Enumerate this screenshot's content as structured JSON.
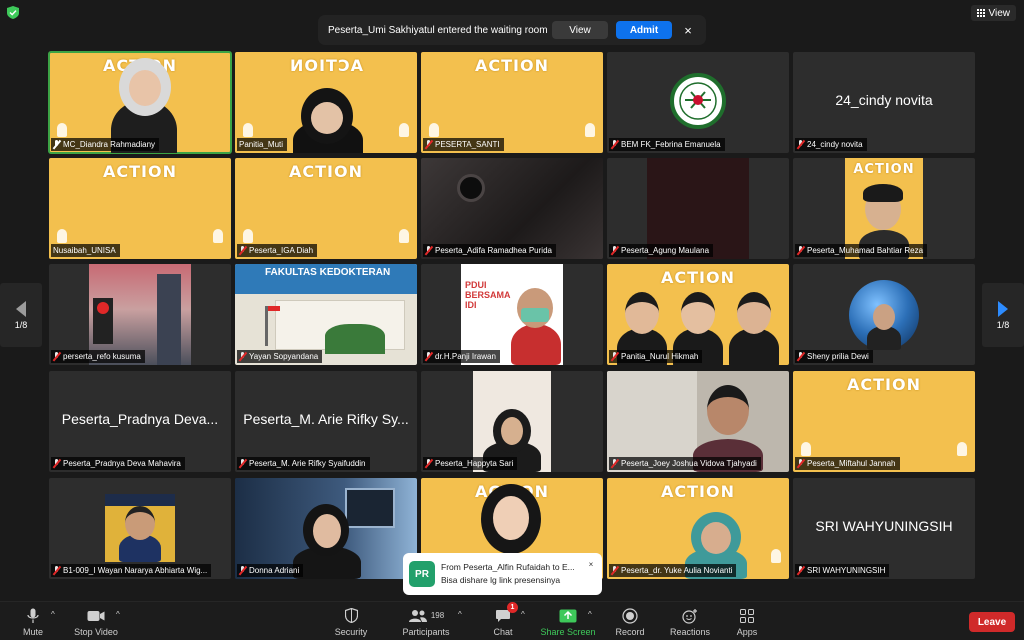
{
  "top": {
    "view_label": "View",
    "notification": {
      "text": "Peserta_Umi Sakhiyatul entered the waiting room",
      "view_label": "View",
      "admit_label": "Admit",
      "close_glyph": "×"
    }
  },
  "pagination": {
    "left": "1/8",
    "right": "1/8"
  },
  "tiles": [
    {
      "name": "MC_Diandra Rahmadiany",
      "mic": "muted-white"
    },
    {
      "name": "Panitia_Muti",
      "mic": "none"
    },
    {
      "name": "PESERTA_SANTI",
      "mic": "muted"
    },
    {
      "name": "BEM FK_Febrina Emanuela",
      "mic": "muted"
    },
    {
      "name": "24_cindy novita",
      "big": "24_cindy novita",
      "mic": "muted"
    },
    {
      "name": "Nusaibah_UNISA",
      "mic": "none"
    },
    {
      "name": "Peserta_IGA Diah",
      "mic": "muted"
    },
    {
      "name": "Peserta_Adifa Ramadhea Purida",
      "mic": "muted"
    },
    {
      "name": "Peserta_Agung Maulana",
      "mic": "muted"
    },
    {
      "name": "Peserta_Muhamad Bahtiar Reza",
      "mic": "muted"
    },
    {
      "name": "perserta_refo kusuma",
      "mic": "muted"
    },
    {
      "name": "Yayan Sopyandana",
      "mic": "muted"
    },
    {
      "name": "dr.H.Panji Irawan",
      "mic": "muted"
    },
    {
      "name": "Panitia_Nurul Hikmah",
      "mic": "muted"
    },
    {
      "name": "Sheny prilia Dewi",
      "mic": "muted"
    },
    {
      "name": "Peserta_Pradnya Deva Mahavira",
      "big": "Peserta_Pradnya Deva...",
      "mic": "muted"
    },
    {
      "name": "Peserta_M. Arie Rifky Syaifuddin",
      "big": "Peserta_M. Arie Rifky Sy...",
      "mic": "muted"
    },
    {
      "name": "Peserta_Happyta Sari",
      "mic": "muted"
    },
    {
      "name": "Peserta_Joey Joshua Vidova Tjahyadi",
      "mic": "muted"
    },
    {
      "name": "Peserta_Miftahul Jannah",
      "mic": "muted"
    },
    {
      "name": "B1-009_I Wayan Nararya Abhiarta Wig...",
      "mic": "muted"
    },
    {
      "name": "Donna Adriani",
      "mic": "muted"
    },
    {
      "name": "",
      "mic": "none"
    },
    {
      "name": "Peserta_dr. Yuke Aulia Novianti",
      "mic": "muted"
    },
    {
      "name": "SRI WAHYUNINGSIH",
      "big": "SRI WAHYUNINGSIH",
      "mic": "muted"
    }
  ],
  "tile_art": {
    "action_word": "ACTION",
    "fk_title": "FAKULTAS KEDOKTERAN",
    "pdui_lines": [
      "PDUI",
      "BERSAMA",
      "IDI"
    ]
  },
  "chat": {
    "avatar": "PR",
    "from": "From Peserta_Alfin Rufaidah to E...",
    "message": "Bisa dishare lg link presensinya",
    "close_glyph": "×"
  },
  "toolbar": {
    "mute": "Mute",
    "stop_video": "Stop Video",
    "security": "Security",
    "participants": "Participants",
    "participants_count": "198",
    "chat": "Chat",
    "chat_badge": "1",
    "share_screen": "Share Screen",
    "record": "Record",
    "reactions": "Reactions",
    "apps": "Apps",
    "leave": "Leave"
  },
  "colors": {
    "accent_blue": "#0e72ed",
    "share_green": "#3ec95a",
    "leave_red": "#d02a2a",
    "action_yellow": "#f3c04e",
    "active_speaker": "#3ca345"
  }
}
